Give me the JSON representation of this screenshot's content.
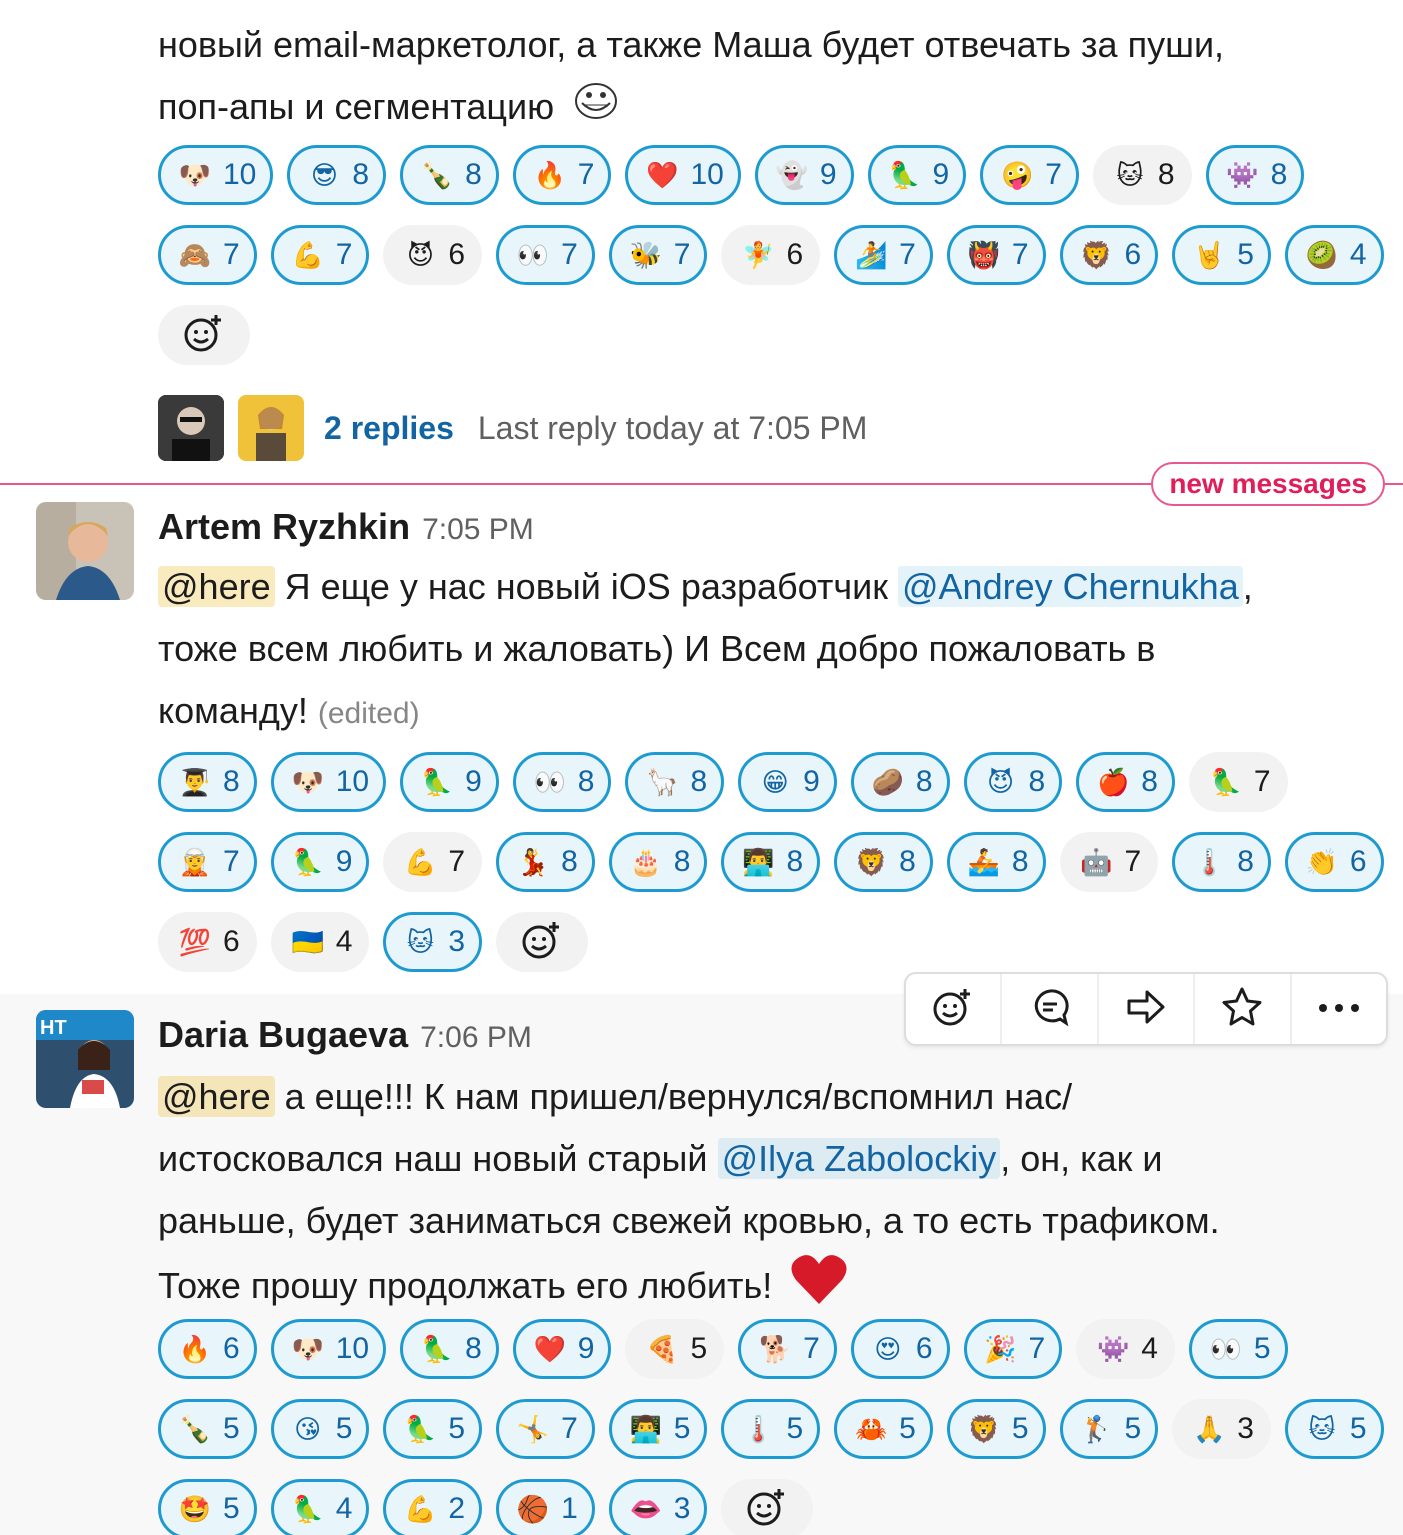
{
  "message0": {
    "text_line1": "новый email-маркетолог, а также Маша будет отвечать за пуши,",
    "text_line2": "поп-апы и сегментацию",
    "inline_emoji": "troll-face",
    "reactions": [
      {
        "emoji": "🐶",
        "name": "doge",
        "count": "10",
        "mine": true
      },
      {
        "emoji": "😎",
        "name": "sunglasses",
        "count": "8",
        "mine": true
      },
      {
        "emoji": "🍾",
        "name": "champagne",
        "count": "8",
        "mine": true
      },
      {
        "emoji": "🔥",
        "name": "fire",
        "count": "7",
        "mine": true
      },
      {
        "emoji": "❤️",
        "name": "heart",
        "count": "10",
        "mine": true
      },
      {
        "emoji": "👻",
        "name": "ghost",
        "count": "9",
        "mine": true
      },
      {
        "emoji": "🦜",
        "name": "parrot",
        "count": "9",
        "mine": true
      },
      {
        "emoji": "🤪",
        "name": "zany-face",
        "count": "7",
        "mine": true
      },
      {
        "emoji": "🐱",
        "name": "cat-photo",
        "count": "8",
        "mine": false
      },
      {
        "emoji": "👾",
        "name": "custom-cat",
        "count": "8",
        "mine": true
      },
      {
        "emoji": "🙈",
        "name": "see-no-evil",
        "count": "7",
        "mine": true
      },
      {
        "emoji": "💪",
        "name": "muscle",
        "count": "7",
        "mine": true
      },
      {
        "emoji": "😈",
        "name": "smiling-imp",
        "count": "6",
        "mine": false
      },
      {
        "emoji": "👀",
        "name": "eyes",
        "count": "7",
        "mine": true
      },
      {
        "emoji": "🐝",
        "name": "bee",
        "count": "7",
        "mine": true
      },
      {
        "emoji": "🧚",
        "name": "fairy",
        "count": "6",
        "mine": false
      },
      {
        "emoji": "🏄",
        "name": "surfer",
        "count": "7",
        "mine": true
      },
      {
        "emoji": "👹",
        "name": "ogre",
        "count": "7",
        "mine": true
      },
      {
        "emoji": "🦁",
        "name": "lion",
        "count": "6",
        "mine": true
      },
      {
        "emoji": "🤘",
        "name": "metal",
        "count": "5",
        "mine": true
      },
      {
        "emoji": "🥝",
        "name": "kiwi",
        "count": "4",
        "mine": true
      }
    ],
    "replies_label": "2 replies",
    "last_reply": "Last reply today at 7:05 PM"
  },
  "new_messages_label": "new messages",
  "message1": {
    "sender": "Artem Ryzhkin",
    "time": "7:05 PM",
    "mention": "@here",
    "text_a": "Я еще у нас новый iOS разработчик",
    "user_mention": "@Andrey Chernukha",
    "text_b": ",",
    "text_line2": "тоже всем любить и жаловать) И Всем добро пожаловать в",
    "text_line3": "команду!",
    "edited": "(edited)",
    "reactions": [
      {
        "emoji": "👨‍🎓",
        "name": "student",
        "count": "8",
        "mine": true
      },
      {
        "emoji": "🐶",
        "name": "doge",
        "count": "10",
        "mine": true
      },
      {
        "emoji": "🦜",
        "name": "parrot",
        "count": "9",
        "mine": true
      },
      {
        "emoji": "👀",
        "name": "eyes",
        "count": "8",
        "mine": true
      },
      {
        "emoji": "🦙",
        "name": "llama",
        "count": "8",
        "mine": true
      },
      {
        "emoji": "😁",
        "name": "grin",
        "count": "9",
        "mine": true
      },
      {
        "emoji": "🥔",
        "name": "potato",
        "count": "8",
        "mine": true
      },
      {
        "emoji": "😈",
        "name": "smiling-imp",
        "count": "8",
        "mine": true
      },
      {
        "emoji": "🍎",
        "name": "apple",
        "count": "8",
        "mine": true
      },
      {
        "emoji": "🦜",
        "name": "party-parrot",
        "count": "7",
        "mine": false
      },
      {
        "emoji": "🧝",
        "name": "elf",
        "count": "7",
        "mine": true
      },
      {
        "emoji": "🦜",
        "name": "parrot-green",
        "count": "9",
        "mine": true
      },
      {
        "emoji": "💪",
        "name": "muscle",
        "count": "7",
        "mine": false
      },
      {
        "emoji": "💃",
        "name": "dancer",
        "count": "8",
        "mine": true
      },
      {
        "emoji": "🎂",
        "name": "cake",
        "count": "8",
        "mine": true
      },
      {
        "emoji": "👨‍💻",
        "name": "technologist",
        "count": "8",
        "mine": true
      },
      {
        "emoji": "🦁",
        "name": "lion",
        "count": "8",
        "mine": true
      },
      {
        "emoji": "🚣",
        "name": "rowboat",
        "count": "8",
        "mine": true
      },
      {
        "emoji": "🤖",
        "name": "robot",
        "count": "7",
        "mine": false
      },
      {
        "emoji": "🌡️",
        "name": "thin-custom",
        "count": "8",
        "mine": true
      },
      {
        "emoji": "👏",
        "name": "clap",
        "count": "6",
        "mine": true
      },
      {
        "emoji": "💯",
        "name": "hundred",
        "count": "6",
        "mine": false
      },
      {
        "emoji": "🇺🇦",
        "name": "flag-ukraine",
        "count": "4",
        "mine": false
      },
      {
        "emoji": "🐱",
        "name": "cat-photo",
        "count": "3",
        "mine": true
      }
    ]
  },
  "message2": {
    "sender": "Daria Bugaeva",
    "time": "7:06 PM",
    "mention": "@here",
    "text_line1": "а еще!!! К нам пришел/вернулся/вспомнил нас/",
    "text_line2a": "истосковался наш новый старый",
    "user_mention": "@Ilya Zabolockiy",
    "text_line2b": ", он, как и",
    "text_line3": "раньше, будет заниматься свежей кровью, а то есть трафиком.",
    "text_line4": "Тоже прошу продолжать его любить!",
    "inline_emoji": "❤️",
    "reactions": [
      {
        "emoji": "🔥",
        "name": "fire",
        "count": "6",
        "mine": true
      },
      {
        "emoji": "🐶",
        "name": "doge",
        "count": "10",
        "mine": true
      },
      {
        "emoji": "🦜",
        "name": "parrot",
        "count": "8",
        "mine": true
      },
      {
        "emoji": "❤️",
        "name": "heart",
        "count": "9",
        "mine": true
      },
      {
        "emoji": "🍕",
        "name": "pizza",
        "count": "5",
        "mine": false
      },
      {
        "emoji": "🐕",
        "name": "corgi",
        "count": "7",
        "mine": true
      },
      {
        "emoji": "😍",
        "name": "heart-eyes",
        "count": "6",
        "mine": true
      },
      {
        "emoji": "🎉",
        "name": "tada",
        "count": "7",
        "mine": true
      },
      {
        "emoji": "👾",
        "name": "custom-cat",
        "count": "4",
        "mine": false
      },
      {
        "emoji": "👀",
        "name": "eyes",
        "count": "5",
        "mine": true
      },
      {
        "emoji": "🍾",
        "name": "champagne",
        "count": "5",
        "mine": true
      },
      {
        "emoji": "😘",
        "name": "kissing-heart",
        "count": "5",
        "mine": true
      },
      {
        "emoji": "🦜",
        "name": "party-parrot",
        "count": "5",
        "mine": true
      },
      {
        "emoji": "🤸",
        "name": "cartwheel",
        "count": "7",
        "mine": true
      },
      {
        "emoji": "👨‍💻",
        "name": "technologist",
        "count": "5",
        "mine": true
      },
      {
        "emoji": "🌡️",
        "name": "thin-custom",
        "count": "5",
        "mine": true
      },
      {
        "emoji": "🦀",
        "name": "crab",
        "count": "5",
        "mine": true
      },
      {
        "emoji": "🦁",
        "name": "lion",
        "count": "5",
        "mine": true
      },
      {
        "emoji": "🏌️",
        "name": "golfer",
        "count": "5",
        "mine": true
      },
      {
        "emoji": "🙏",
        "name": "pray",
        "count": "3",
        "mine": false
      },
      {
        "emoji": "🐱",
        "name": "cat-photo",
        "count": "5",
        "mine": true
      },
      {
        "emoji": "🤩",
        "name": "star-struck",
        "count": "5",
        "mine": true
      },
      {
        "emoji": "🦜",
        "name": "parrot-blue",
        "count": "4",
        "mine": true
      },
      {
        "emoji": "💪",
        "name": "muscle",
        "count": "2",
        "mine": true
      },
      {
        "emoji": "🏀",
        "name": "basketball",
        "count": "1",
        "mine": true
      },
      {
        "emoji": "👄",
        "name": "lips",
        "count": "3",
        "mine": true
      }
    ]
  },
  "toolbar": {
    "buttons": [
      "add-reaction",
      "reply-in-thread",
      "share-message",
      "save",
      "more-actions"
    ]
  },
  "colors": {
    "mine_border": "#1d9bd1",
    "mine_bg": "#e8f5fa",
    "link": "#1264a3",
    "new_messages": "#e01e5a"
  }
}
